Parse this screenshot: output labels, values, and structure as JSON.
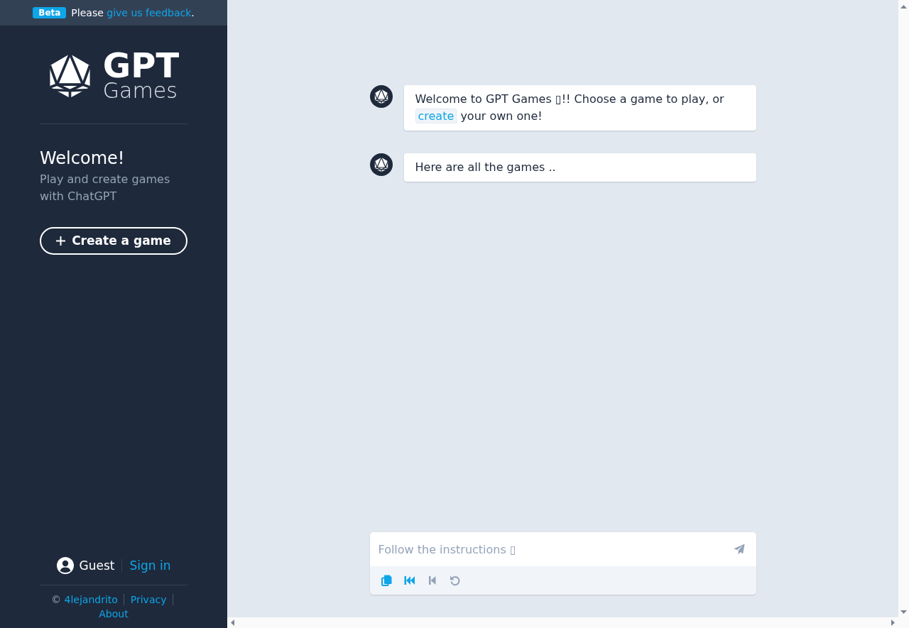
{
  "banner": {
    "badge": "Beta",
    "before": "Please",
    "link": "give us feedback",
    "after": "."
  },
  "sidebar": {
    "logo": {
      "title": "GPT",
      "subtitle": "Games"
    },
    "welcome": {
      "heading": "Welcome!",
      "text": "Play and create games with ChatGPT"
    },
    "create_button": {
      "label": "Create a game"
    },
    "user": {
      "name": "Guest",
      "sign_in": "Sign in"
    },
    "footer": {
      "copyright": "©",
      "links": [
        "4lejandrito",
        "Privacy",
        "About"
      ]
    }
  },
  "chat": {
    "messages": [
      {
        "parts": [
          {
            "kind": "text",
            "text": "Welcome to GPT Games ▯!! Choose a game to play, or"
          },
          {
            "kind": "link",
            "text": "create"
          },
          {
            "kind": "text",
            "text": "your own one!"
          }
        ]
      },
      {
        "parts": [
          {
            "kind": "text",
            "text": "Here are all the games .."
          }
        ]
      }
    ],
    "composer": {
      "placeholder": "Follow the instructions ▯",
      "tools": [
        {
          "kind": "copy",
          "disabled": false
        },
        {
          "kind": "rewind",
          "disabled": false
        },
        {
          "kind": "step-back",
          "disabled": true
        },
        {
          "kind": "undo",
          "disabled": true
        }
      ]
    }
  }
}
